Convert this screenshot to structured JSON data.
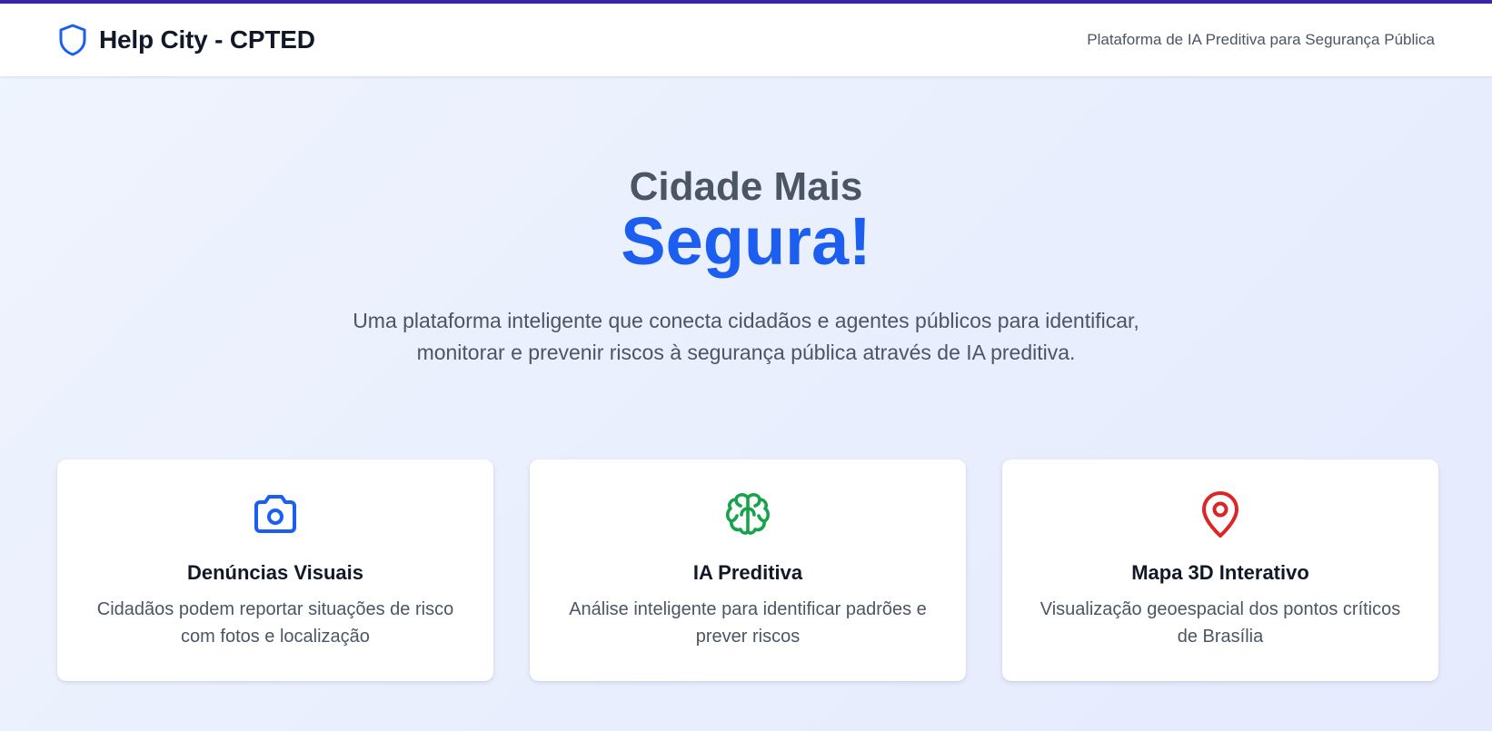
{
  "header": {
    "title": "Help City - CPTED",
    "tagline": "Plataforma de IA Preditiva para Segurança Pública",
    "icon": "shield-icon"
  },
  "hero": {
    "line1": "Cidade Mais",
    "line2": "Segura!",
    "description": "Uma plataforma inteligente que conecta cidadãos e agentes públicos para identificar, monitorar e prevenir riscos à segurança pública através de IA preditiva."
  },
  "features": [
    {
      "icon": "camera-icon",
      "color": "#1c5ff0",
      "title": "Denúncias Visuais",
      "description": "Cidadãos podem reportar situações de risco com fotos e localização"
    },
    {
      "icon": "brain-icon",
      "color": "#16a34a",
      "title": "IA Preditiva",
      "description": "Análise inteligente para identificar padrões e prever riscos"
    },
    {
      "icon": "map-pin-icon",
      "color": "#dc2626",
      "title": "Mapa 3D Interativo",
      "description": "Visualização geoespacial dos pontos críticos de Brasília"
    }
  ],
  "colors": {
    "accent": "#1c5ff0",
    "top_bar": "#3b28a8",
    "text_dark": "#111827",
    "text_muted": "#4b5563"
  }
}
